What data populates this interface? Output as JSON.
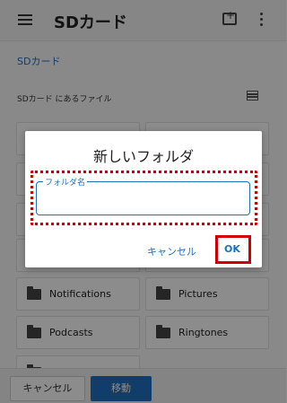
{
  "app": {
    "title": "SDカード",
    "breadcrumb": "SDカード",
    "section_label": "SDカード にあるファイル"
  },
  "tiles": [
    {
      "name": "Notifications"
    },
    {
      "name": "Pictures"
    },
    {
      "name": "Podcasts"
    },
    {
      "name": "Ringtones"
    }
  ],
  "bottom": {
    "cancel": "キャンセル",
    "move": "移動"
  },
  "dialog": {
    "title": "新しいフォルダ",
    "field_label": "フォルダ名",
    "field_value": "",
    "cancel": "キャンセル",
    "ok": "OK"
  },
  "icons": {
    "menu": "hamburger-icon",
    "new_folder": "new-folder-icon",
    "more": "more-vert-icon",
    "view": "list-view-icon",
    "folder": "folder-icon"
  },
  "colors": {
    "accent": "#1e6fc0",
    "annotation": "#d00000"
  }
}
